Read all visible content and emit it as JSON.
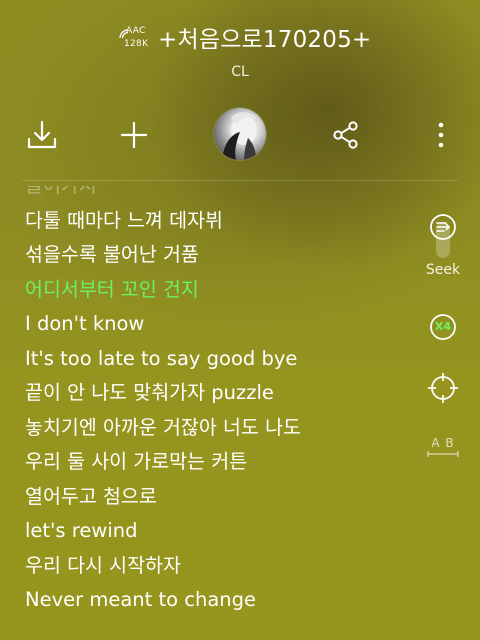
{
  "header": {
    "quality_top": "AAC",
    "quality_bottom": "128K",
    "title": "+처음으로170205+",
    "artist": "CL"
  },
  "toolbar": {
    "download_icon": "download-icon",
    "add_icon": "plus-icon",
    "share_icon": "share-icon",
    "more_icon": "more-vertical-icon"
  },
  "lyrics": {
    "partial_line": "끌어가지",
    "lines": [
      "다툴 때마다 느껴 데자뷔",
      "섞을수록 불어난 거품",
      "어디서부터 꼬인 건지",
      "I don't know",
      "It's too late to say good bye",
      "끝이 안 나도 맞춰가자 puzzle",
      "놓치기엔 아까운 거잖아 너도 나도",
      "우리 둘 사이 가로막는 커튼",
      "열어두고 첨으로",
      "let's rewind",
      "우리 다시 시작하자",
      "Never meant to change"
    ],
    "current_index": 2
  },
  "side_controls": {
    "seek_label": "Seek",
    "speed_label": "X4",
    "ab_label": "A B"
  },
  "colors": {
    "highlight": "#6cf06a",
    "background": "#909020"
  }
}
